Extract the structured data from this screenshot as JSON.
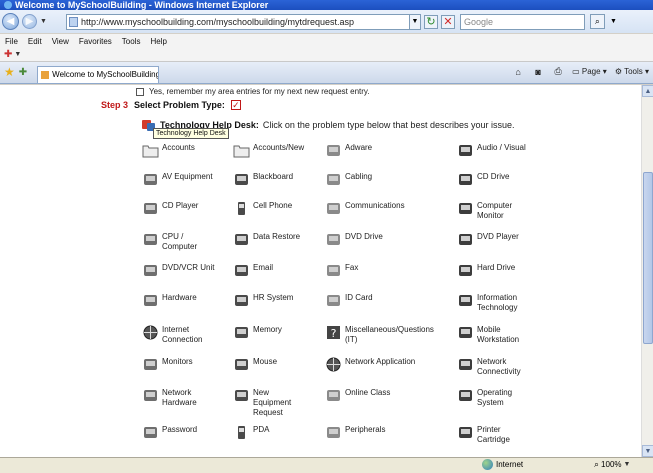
{
  "window": {
    "title": "Welcome to MySchoolBuilding - Windows Internet Explorer"
  },
  "address": {
    "url": "http://www.myschoolbuilding.com/myschoolbuilding/mytdrequest.asp",
    "search_placeholder": "Google"
  },
  "menu": [
    "File",
    "Edit",
    "View",
    "Favorites",
    "Tools",
    "Help"
  ],
  "tab": {
    "label": "Welcome to MySchoolBuilding"
  },
  "toolbar": {
    "page_label": "Page",
    "tools_label": "Tools"
  },
  "form": {
    "remember_label": "Yes, remember my area entries for my next new request entry.",
    "step_label": "Step 3",
    "step_title": "Select Problem Type:",
    "helpdesk_title": "Technology Help Desk:",
    "helpdesk_text": "Click on the problem type below that best describes your issue.",
    "tooltip": "Technology Help Desk"
  },
  "problem_types": [
    {
      "label": "Accounts",
      "icon": "folder-icon"
    },
    {
      "label": "Accounts/New",
      "icon": "folder-add-icon"
    },
    {
      "label": "Adware",
      "icon": "spy-icon"
    },
    {
      "label": "Audio / Visual",
      "icon": "microphone-icon"
    },
    {
      "label": "AV Equipment",
      "icon": "satellite-icon"
    },
    {
      "label": "Blackboard",
      "icon": "blackboard-icon"
    },
    {
      "label": "Cabling",
      "icon": "cable-icon"
    },
    {
      "label": "CD Drive",
      "icon": "cd-drive-icon"
    },
    {
      "label": "CD Player",
      "icon": "cd-player-icon"
    },
    {
      "label": "Cell Phone",
      "icon": "cell-phone-icon"
    },
    {
      "label": "Communications",
      "icon": "communications-icon"
    },
    {
      "label": "Computer\nMonitor",
      "icon": "monitor-icon"
    },
    {
      "label": "CPU /\nComputer",
      "icon": "cpu-icon"
    },
    {
      "label": "Data Restore",
      "icon": "data-restore-icon"
    },
    {
      "label": "DVD Drive",
      "icon": "dvd-drive-icon"
    },
    {
      "label": "DVD Player",
      "icon": "dvd-player-icon"
    },
    {
      "label": "DVD/VCR Unit",
      "icon": "dvd-vcr-icon"
    },
    {
      "label": "Email",
      "icon": "email-icon"
    },
    {
      "label": "Fax",
      "icon": "fax-icon"
    },
    {
      "label": "Hard Drive",
      "icon": "hard-drive-icon"
    },
    {
      "label": "Hardware",
      "icon": "hardware-icon"
    },
    {
      "label": "HR System",
      "icon": "hr-system-icon"
    },
    {
      "label": "ID Card",
      "icon": "id-card-icon"
    },
    {
      "label": "Information\nTechnology",
      "icon": "mouse-it-icon"
    },
    {
      "label": "Internet\nConnection",
      "icon": "globe-icon"
    },
    {
      "label": "Memory",
      "icon": "memory-icon"
    },
    {
      "label": "Miscellaneous/Questions\n(IT)",
      "icon": "question-icon"
    },
    {
      "label": "Mobile\nWorkstation",
      "icon": "mobile-workstation-icon"
    },
    {
      "label": "Monitors",
      "icon": "monitors-icon"
    },
    {
      "label": "Mouse",
      "icon": "mouse-icon"
    },
    {
      "label": "Network Application",
      "icon": "network-app-icon"
    },
    {
      "label": "Network\nConnectivity",
      "icon": "network-connectivity-icon"
    },
    {
      "label": "Network\nHardware",
      "icon": "network-hardware-icon"
    },
    {
      "label": "New\nEquipment\nRequest",
      "icon": "new-equipment-icon"
    },
    {
      "label": "Online Class",
      "icon": "online-class-icon"
    },
    {
      "label": "Operating\nSystem",
      "icon": "operating-system-icon"
    },
    {
      "label": "Password",
      "icon": "password-icon"
    },
    {
      "label": "PDA",
      "icon": "pda-icon"
    },
    {
      "label": "Peripherals",
      "icon": "peripherals-icon"
    },
    {
      "label": "Printer\nCartridge",
      "icon": "printer-icon"
    }
  ],
  "status": {
    "zone": "Internet",
    "zoom": "100%"
  }
}
